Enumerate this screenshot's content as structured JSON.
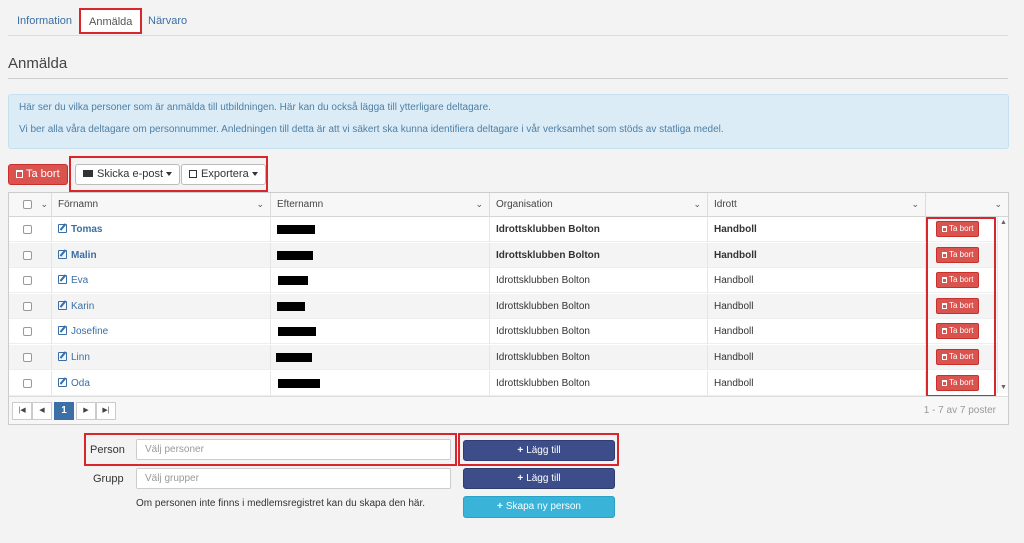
{
  "tabs": [
    {
      "label": "Information",
      "active": false
    },
    {
      "label": "Anmälda",
      "active": true
    },
    {
      "label": "Närvaro",
      "active": false
    }
  ],
  "page_title": "Anmälda",
  "alert": {
    "line1": "Här ser du vilka personer som är anmälda till utbildningen. Här kan du också lägga till ytterligare deltagare.",
    "line2": "Vi ber alla våra deltagare om personnummer. Anledningen till detta är att vi säkert ska kunna identifiera deltagare i vår verksamhet som stöds av statliga medel."
  },
  "toolbar": {
    "delete_label": "Ta bort",
    "email_label": "Skicka e-post",
    "export_label": "Exportera"
  },
  "grid": {
    "columns": [
      "Förnamn",
      "Efternamn",
      "Organisation",
      "Idrott"
    ],
    "row_delete_label": "Ta bort",
    "rows": [
      {
        "first": "Tomas",
        "org": "Idrottsklubben Bolton",
        "sport": "Handboll",
        "bold": true
      },
      {
        "first": "Malin",
        "org": "Idrottsklubben Bolton",
        "sport": "Handboll",
        "bold": true
      },
      {
        "first": "Eva",
        "org": "Idrottsklubben Bolton",
        "sport": "Handboll",
        "bold": false
      },
      {
        "first": "Karin",
        "org": "Idrottsklubben Bolton",
        "sport": "Handboll",
        "bold": false
      },
      {
        "first": "Josefine",
        "org": "Idrottsklubben Bolton",
        "sport": "Handboll",
        "bold": false
      },
      {
        "first": "Linn",
        "org": "Idrottsklubben Bolton",
        "sport": "Handboll",
        "bold": false
      },
      {
        "first": "Oda",
        "org": "Idrottsklubben Bolton",
        "sport": "Handboll",
        "bold": false
      }
    ],
    "pager": {
      "current_page": "1",
      "info": "1 - 7 av 7 poster"
    }
  },
  "add_form": {
    "person_label": "Person",
    "person_placeholder": "Välj personer",
    "group_label": "Grupp",
    "group_placeholder": "Välj grupper",
    "add_label": "Lägg till",
    "note": "Om personen inte finns i medlemsregistret kan du skapa den här.",
    "create_label": "Skapa ny person"
  },
  "colors": {
    "highlight": "#d9262d",
    "danger": "#d9534f",
    "primary": "#3c4d8a",
    "info": "#39b3d7"
  },
  "icons": [
    "trash-icon",
    "envelope-icon",
    "export-icon",
    "edit-icon",
    "plus-icon",
    "chevron-down-icon",
    "first-page-icon",
    "prev-page-icon",
    "next-page-icon",
    "last-page-icon"
  ]
}
